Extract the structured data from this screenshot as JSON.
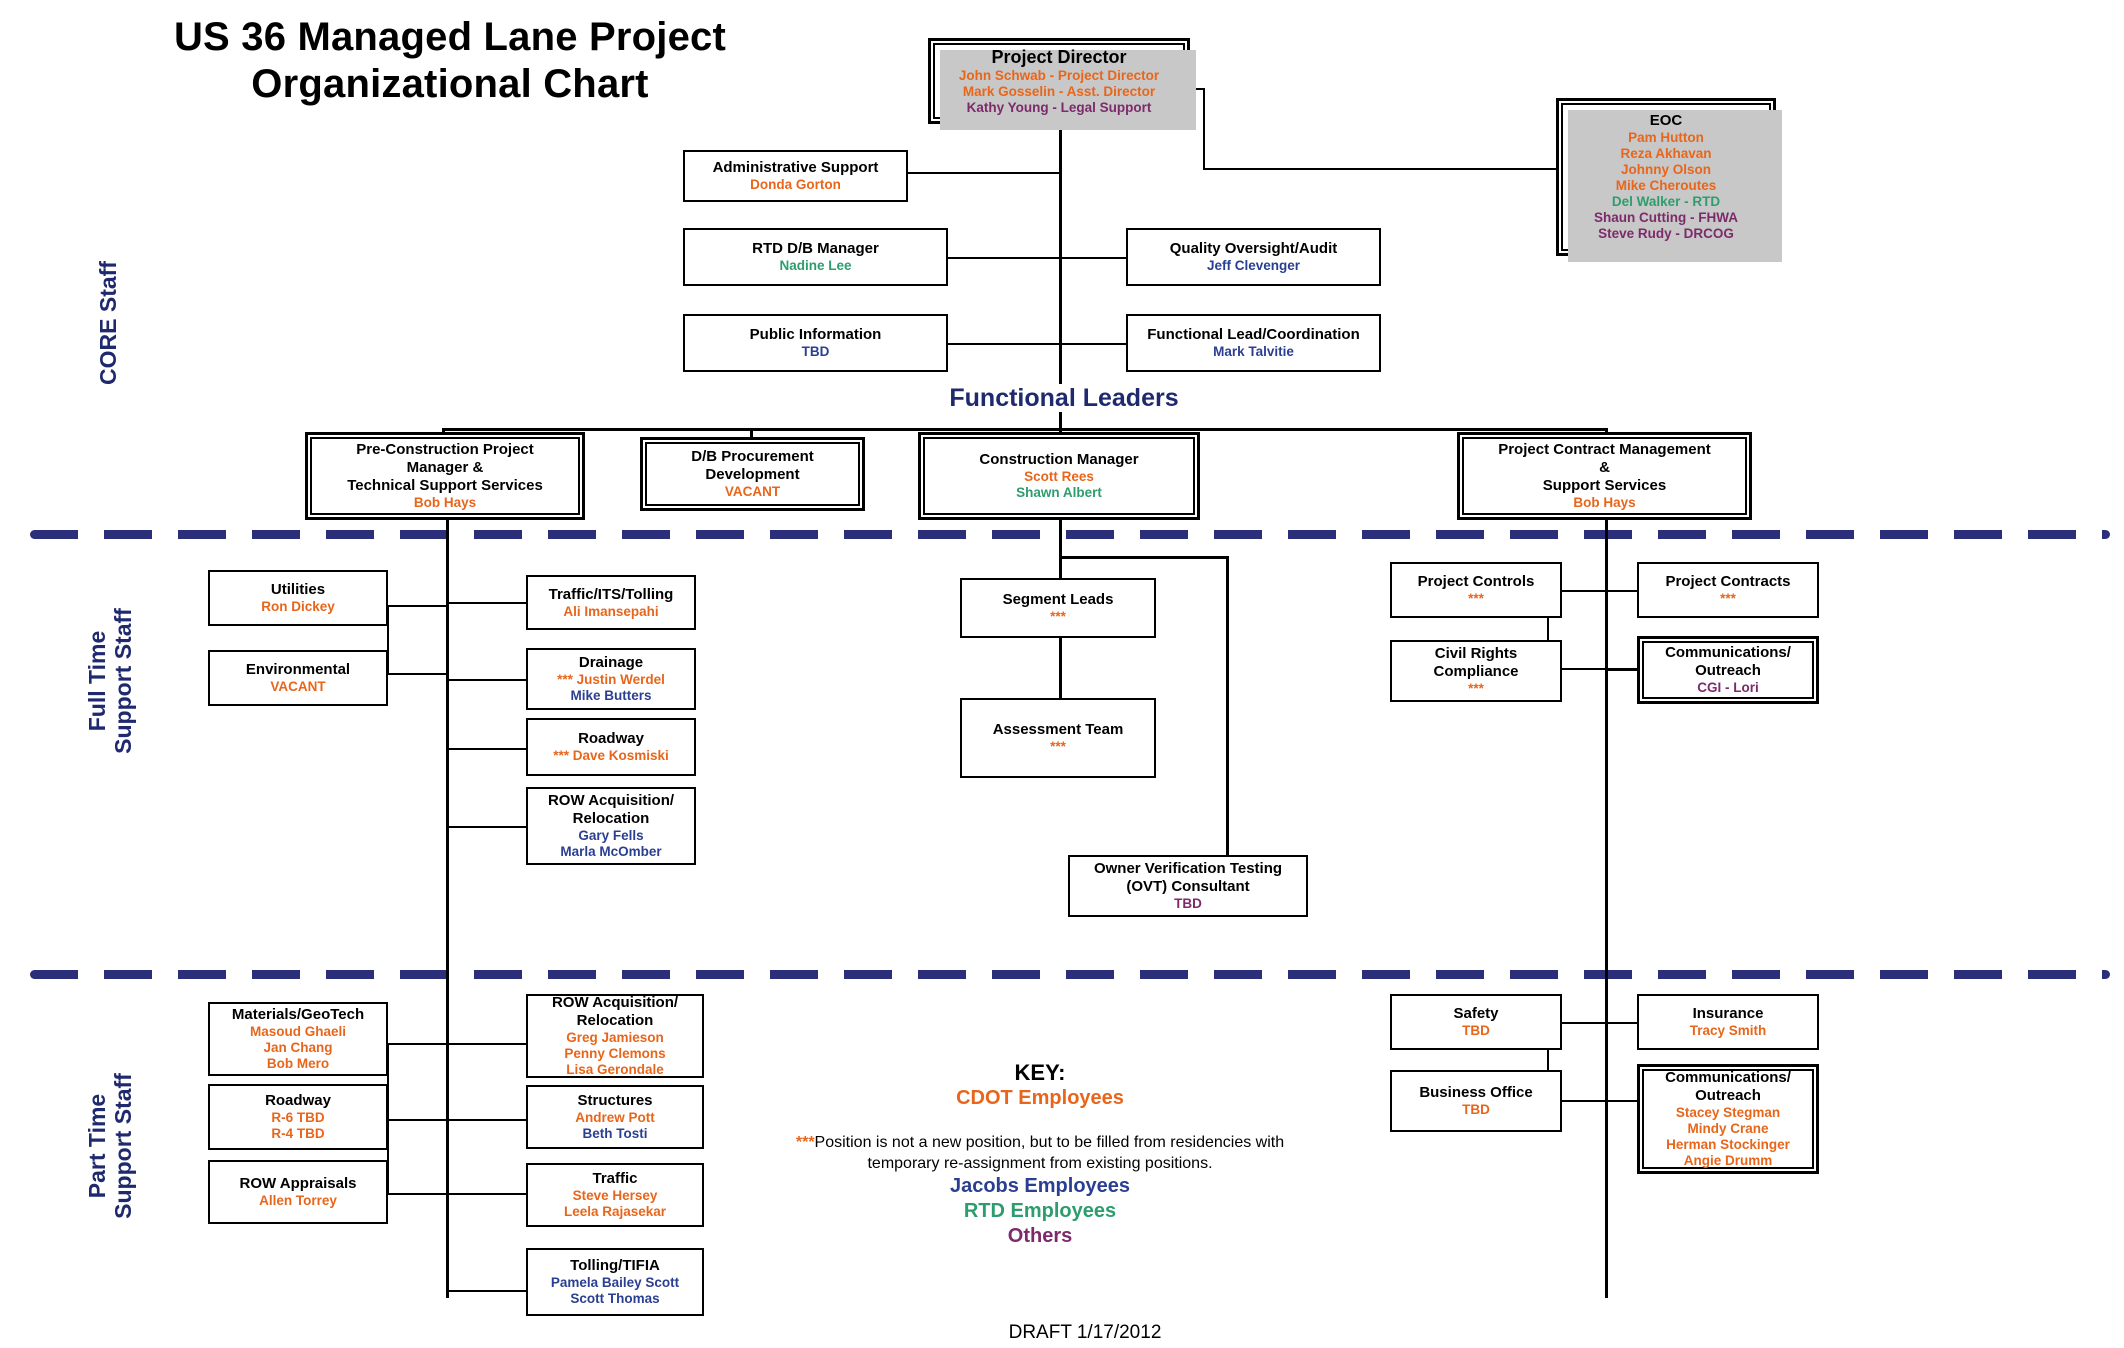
{
  "title": "US 36 Managed Lane Project\nOrganizational Chart",
  "functional_leaders_label": "Functional Leaders",
  "sections": {
    "core": "CORE Staff",
    "full_time": "Full Time\nSupport Staff",
    "part_time": "Part Time\nSupport Staff"
  },
  "boxes": {
    "project_director": {
      "title": "Project Director",
      "lines": [
        {
          "text": "John Schwab - Project Director",
          "group": "cdot"
        },
        {
          "text": "Mark Gosselin - Asst. Director",
          "group": "cdot"
        },
        {
          "text": "Kathy Young - Legal Support",
          "group": "others"
        }
      ]
    },
    "eoc": {
      "title": "EOC",
      "lines": [
        {
          "text": "Pam Hutton",
          "group": "cdot"
        },
        {
          "text": "Reza Akhavan",
          "group": "cdot"
        },
        {
          "text": "Johnny Olson",
          "group": "cdot"
        },
        {
          "text": "Mike Cheroutes",
          "group": "cdot"
        },
        {
          "text": "Del Walker - RTD",
          "group": "rtd"
        },
        {
          "text": "Shaun Cutting - FHWA",
          "group": "others"
        },
        {
          "text": "Steve Rudy - DRCOG",
          "group": "others"
        }
      ]
    },
    "administrative_support": {
      "title": "Administrative Support",
      "lines": [
        {
          "text": "Donda Gorton",
          "group": "cdot"
        }
      ]
    },
    "rtd_db_manager": {
      "title": "RTD D/B Manager",
      "lines": [
        {
          "text": "Nadine Lee",
          "group": "rtd"
        }
      ]
    },
    "quality_oversight": {
      "title": "Quality Oversight/Audit",
      "lines": [
        {
          "text": "Jeff Clevenger",
          "group": "jacobs"
        }
      ]
    },
    "public_information": {
      "title": "Public Information",
      "lines": [
        {
          "text": "TBD",
          "group": "jacobs"
        }
      ]
    },
    "functional_lead": {
      "title": "Functional Lead/Coordination",
      "lines": [
        {
          "text": "Mark Talvitie",
          "group": "jacobs"
        }
      ]
    },
    "pre_construction": {
      "title": "Pre-Construction Project\nManager &\nTechnical Support Services",
      "lines": [
        {
          "text": "Bob Hays",
          "group": "cdot"
        }
      ]
    },
    "db_procurement": {
      "title": "D/B Procurement\nDevelopment",
      "lines": [
        {
          "text": "VACANT",
          "group": "cdot"
        }
      ]
    },
    "construction_manager": {
      "title": "Construction Manager",
      "lines": [
        {
          "text": "Scott Rees",
          "group": "cdot"
        },
        {
          "text": "Shawn Albert",
          "group": "rtd"
        }
      ]
    },
    "project_contract_mgmt": {
      "title": "Project Contract Management\n&\nSupport Services",
      "lines": [
        {
          "text": "Bob Hays",
          "group": "cdot"
        }
      ]
    },
    "utilities": {
      "title": "Utilities",
      "lines": [
        {
          "text": "Ron Dickey",
          "group": "cdot"
        }
      ]
    },
    "environmental": {
      "title": "Environmental",
      "lines": [
        {
          "text": "VACANT",
          "group": "cdot"
        }
      ]
    },
    "traffic_its_tolling": {
      "title": "Traffic/ITS/Tolling",
      "lines": [
        {
          "text": "Ali Imansepahi",
          "group": "cdot"
        }
      ]
    },
    "drainage": {
      "title": "Drainage",
      "lines": [
        {
          "text": "*** Justin Werdel",
          "group": "cdot"
        },
        {
          "text": "Mike Butters",
          "group": "jacobs"
        }
      ]
    },
    "roadway_ft": {
      "title": "Roadway",
      "lines": [
        {
          "text": "*** Dave Kosmiski",
          "group": "cdot"
        }
      ]
    },
    "row_acq_ft": {
      "title": "ROW Acquisition/\nRelocation",
      "lines": [
        {
          "text": "Gary Fells",
          "group": "jacobs"
        },
        {
          "text": "Marla McOmber",
          "group": "jacobs"
        }
      ]
    },
    "segment_leads": {
      "title": "Segment Leads",
      "lines": [
        {
          "text": "***",
          "group": "cdot"
        }
      ]
    },
    "assessment_team": {
      "title": "Assessment Team",
      "lines": [
        {
          "text": "***",
          "group": "cdot"
        }
      ]
    },
    "ovt_consultant": {
      "title": "Owner Verification Testing\n(OVT) Consultant",
      "lines": [
        {
          "text": "TBD",
          "group": "others"
        }
      ]
    },
    "project_controls": {
      "title": "Project Controls",
      "lines": [
        {
          "text": "***",
          "group": "cdot"
        }
      ]
    },
    "civil_rights": {
      "title": "Civil Rights\nCompliance",
      "lines": [
        {
          "text": "***",
          "group": "cdot"
        }
      ]
    },
    "project_contracts": {
      "title": "Project Contracts",
      "lines": [
        {
          "text": "***",
          "group": "cdot"
        }
      ]
    },
    "communications_ft": {
      "title": "Communications/\nOutreach",
      "lines": [
        {
          "text": "CGI - Lori",
          "group": "others"
        }
      ]
    },
    "materials_geotech": {
      "title": "Materials/GeoTech",
      "lines": [
        {
          "text": "Masoud Ghaeli",
          "group": "cdot"
        },
        {
          "text": "Jan Chang",
          "group": "cdot"
        },
        {
          "text": "Bob Mero",
          "group": "cdot"
        }
      ]
    },
    "roadway_pt": {
      "title": "Roadway",
      "lines": [
        {
          "text": "R-6 TBD",
          "group": "cdot"
        },
        {
          "text": "R-4 TBD",
          "group": "cdot"
        }
      ]
    },
    "row_appraisals": {
      "title": "ROW Appraisals",
      "lines": [
        {
          "text": "Allen Torrey",
          "group": "cdot"
        }
      ]
    },
    "row_acq_pt": {
      "title": "ROW Acquisition/\nRelocation",
      "lines": [
        {
          "text": "Greg Jamieson",
          "group": "cdot"
        },
        {
          "text": "Penny Clemons",
          "group": "cdot"
        },
        {
          "text": "Lisa Gerondale",
          "group": "cdot"
        }
      ]
    },
    "structures": {
      "title": "Structures",
      "lines": [
        {
          "text": "Andrew Pott",
          "group": "cdot"
        },
        {
          "text": "Beth Tosti",
          "group": "jacobs"
        }
      ]
    },
    "traffic_pt": {
      "title": "Traffic",
      "lines": [
        {
          "text": "Steve Hersey",
          "group": "cdot"
        },
        {
          "text": "Leela Rajasekar",
          "group": "cdot"
        }
      ]
    },
    "tolling_tifia": {
      "title": "Tolling/TIFIA",
      "lines": [
        {
          "text": "Pamela Bailey Scott",
          "group": "jacobs"
        },
        {
          "text": "Scott Thomas",
          "group": "jacobs"
        }
      ]
    },
    "safety": {
      "title": "Safety",
      "lines": [
        {
          "text": "TBD",
          "group": "cdot"
        }
      ]
    },
    "business_office": {
      "title": "Business Office",
      "lines": [
        {
          "text": "TBD",
          "group": "cdot"
        }
      ]
    },
    "insurance": {
      "title": "Insurance",
      "lines": [
        {
          "text": "Tracy Smith",
          "group": "cdot"
        }
      ]
    },
    "communications_pt": {
      "title": "Communications/\nOutreach",
      "lines": [
        {
          "text": "Stacey Stegman",
          "group": "cdot"
        },
        {
          "text": "Mindy Crane",
          "group": "cdot"
        },
        {
          "text": "Herman Stockinger",
          "group": "cdot"
        },
        {
          "text": "Angie Drumm",
          "group": "cdot"
        }
      ]
    }
  },
  "key": {
    "heading": "KEY:",
    "cdot": "CDOT Employees",
    "note": "Position is not a new position, but to be filled from residencies with\ntemporary re-assignment from existing positions.",
    "note_asterisks": "***",
    "jacobs": "Jacobs Employees",
    "rtd": "RTD Employees",
    "others": "Others"
  },
  "footer": "DRAFT 1/17/2012",
  "colors": {
    "cdot": "#e8661b",
    "jacobs": "#2b3f92",
    "rtd": "#2e9d6e",
    "others": "#7d2a6b",
    "navy": "#1f2a6e"
  }
}
